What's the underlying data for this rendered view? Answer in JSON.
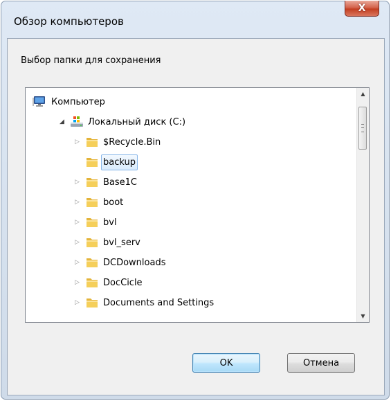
{
  "window": {
    "title": "Обзор компьютеров",
    "close_label": "X"
  },
  "prompt": "Выбор папки для сохранения",
  "tree": {
    "items": [
      {
        "label": "Компьютер",
        "level": 0,
        "icon": "computer-icon",
        "expander": "none",
        "selected": false
      },
      {
        "label": "Локальный диск (C:)",
        "level": 1,
        "icon": "local-disk-icon",
        "expander": "expanded",
        "selected": false
      },
      {
        "label": "$Recycle.Bin",
        "level": 2,
        "icon": "folder-icon",
        "expander": "collapsed",
        "selected": false
      },
      {
        "label": "backup",
        "level": 2,
        "icon": "folder-icon",
        "expander": "none",
        "selected": true
      },
      {
        "label": "Base1C",
        "level": 2,
        "icon": "folder-icon",
        "expander": "collapsed",
        "selected": false
      },
      {
        "label": "boot",
        "level": 2,
        "icon": "folder-icon",
        "expander": "collapsed",
        "selected": false
      },
      {
        "label": "bvl",
        "level": 2,
        "icon": "folder-icon",
        "expander": "collapsed",
        "selected": false
      },
      {
        "label": "bvl_serv",
        "level": 2,
        "icon": "folder-icon",
        "expander": "collapsed",
        "selected": false
      },
      {
        "label": "DCDownloads",
        "level": 2,
        "icon": "folder-icon",
        "expander": "collapsed",
        "selected": false
      },
      {
        "label": "DocCicle",
        "level": 2,
        "icon": "folder-icon",
        "expander": "collapsed",
        "selected": false
      },
      {
        "label": "Documents and Settings",
        "level": 2,
        "icon": "folder-icon",
        "expander": "collapsed",
        "selected": false
      }
    ]
  },
  "buttons": {
    "ok": "OK",
    "cancel": "Отмена"
  },
  "colors": {
    "selection_border": "#88b6e8",
    "close_button": "#c33f22",
    "folder": "#f5c842"
  }
}
